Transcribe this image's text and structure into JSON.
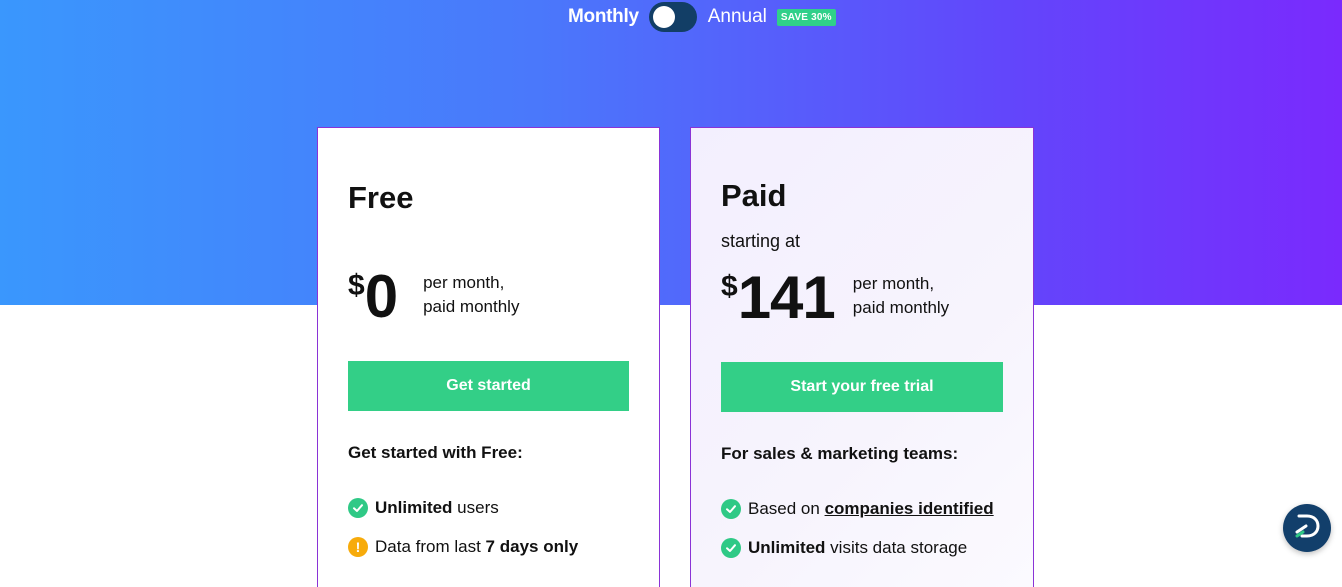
{
  "billing_toggle": {
    "monthly_label": "Monthly",
    "annual_label": "Annual",
    "save_badge": "SAVE 30%",
    "selected": "Monthly"
  },
  "colors": {
    "gradient_start": "#3a97fd",
    "gradient_end": "#7a2afd",
    "cta_green": "#33cf87",
    "check_green": "#2fc986",
    "warning_orange": "#f7ab0b",
    "card_border": "#8a33d6",
    "toggle_dark": "#123e66"
  },
  "plans": {
    "free": {
      "name": "Free",
      "currency": "$",
      "amount": "0",
      "price_note_line1": "per month,",
      "price_note_line2": "paid monthly",
      "cta": "Get started",
      "section_heading": "Get started with Free:",
      "features": [
        {
          "icon": "check-icon",
          "bold": "Unlimited",
          "text": " users"
        },
        {
          "icon": "warning-icon",
          "text": "Data from last ",
          "bold": "7 days only"
        }
      ]
    },
    "paid": {
      "name": "Paid",
      "starting_at": "starting at",
      "currency": "$",
      "amount": "141",
      "price_note_line1": "per month,",
      "price_note_line2": "paid monthly",
      "cta": "Start your free trial",
      "section_heading": "For sales & marketing teams:",
      "features": [
        {
          "icon": "check-icon",
          "text": "Based on ",
          "link": "companies identified"
        },
        {
          "icon": "check-icon",
          "bold": "Unlimited",
          "text": " visits data storage"
        }
      ]
    }
  },
  "chat_launcher": {
    "icon": "chat-logo-icon"
  }
}
